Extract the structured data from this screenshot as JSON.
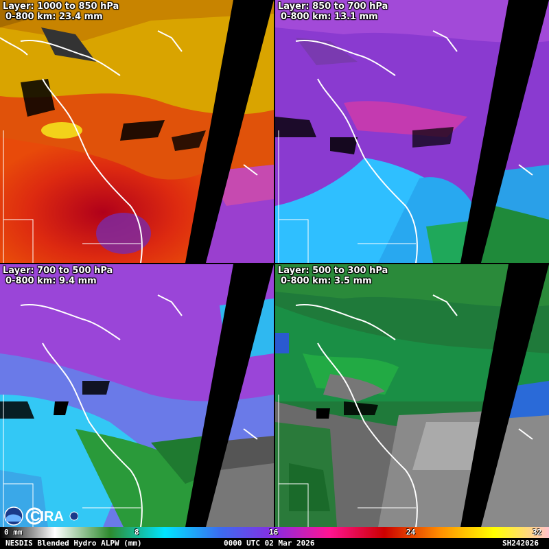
{
  "panels": [
    {
      "layer": "Layer: 1000 to 850 hPa",
      "range": "0-800 km: 23.4 mm",
      "palette": "warm"
    },
    {
      "layer": "Layer: 850 to 700 hPa",
      "range": "0-800 km: 13.1 mm",
      "palette": "purple"
    },
    {
      "layer": "Layer: 700 to 500 hPa",
      "range": "0-800 km: 9.4 mm",
      "palette": "cyan"
    },
    {
      "layer": "Layer: 500 to 300 hPa",
      "range": "0-800 km: 3.5 mm",
      "palette": "green"
    }
  ],
  "colorbar": {
    "ticks": [
      "0 mm",
      "8",
      "16",
      "24",
      "32"
    ],
    "stops": [
      "#000000",
      "#ffffff",
      "#2e8b2e",
      "#00e5ff",
      "#3a6df0",
      "#8a2be2",
      "#ff1493",
      "#cc0000",
      "#ff8c00",
      "#ffff00",
      "#ffc0cb"
    ]
  },
  "footer": {
    "product": "NESDIS Blended Hydro ALPW (mm)",
    "time": "0000 UTC 02 Mar 2026",
    "id": "SH242026"
  },
  "logos": {
    "noaa": "NOAA",
    "cira": "CIRA"
  }
}
